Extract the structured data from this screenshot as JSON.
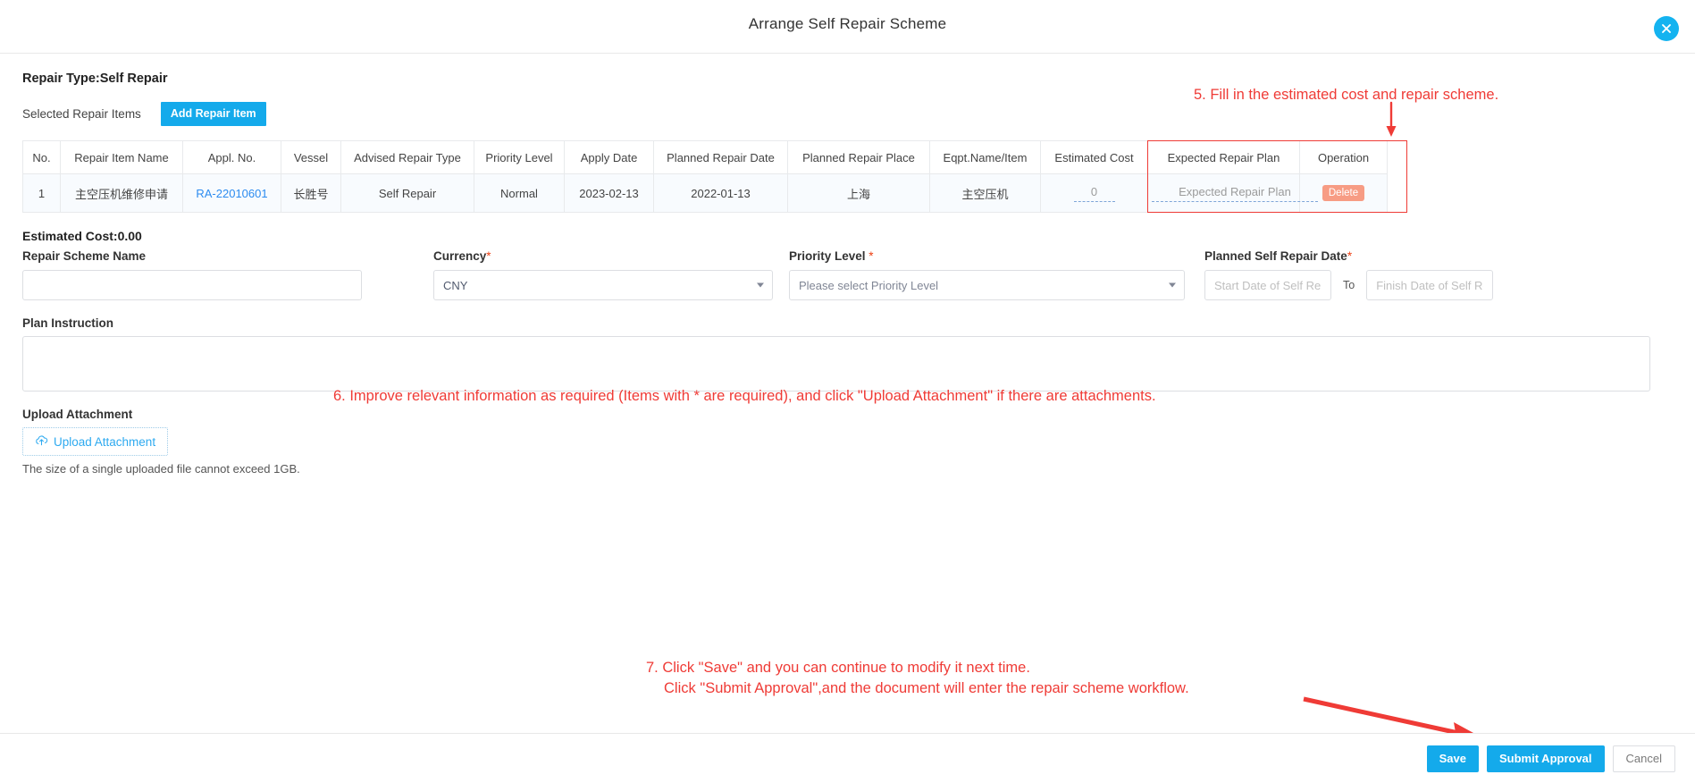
{
  "header": {
    "title": "Arrange Self Repair Scheme",
    "close_icon": "close-circle-icon"
  },
  "body": {
    "repair_type": "Repair Type:Self Repair",
    "selected_items_label": "Selected Repair Items",
    "add_repair_item_label": "Add Repair Item",
    "estimated_cost_summary": "Estimated Cost:0.00"
  },
  "table": {
    "columns": [
      "No.",
      "Repair Item Name",
      "Appl. No.",
      "Vessel",
      "Advised Repair Type",
      "Priority Level",
      "Apply Date",
      "Planned Repair Date",
      "Planned Repair Place",
      "Eqpt.Name/Item",
      "Estimated Cost",
      "Expected Repair Plan",
      "Operation"
    ],
    "rows": [
      {
        "no": "1",
        "repair_item_name": "主空压机维修申请",
        "appl_no": "RA-22010601",
        "vessel": "长胜号",
        "advised_repair_type": "Self Repair",
        "priority_level": "Normal",
        "apply_date": "2023-02-13",
        "planned_repair_date": "2022-01-13",
        "planned_repair_place": "上海",
        "eqpt_name_item": "主空压机",
        "estimated_cost": "0",
        "expected_repair_plan_placeholder": "Expected Repair Plan",
        "operation_label": "Delete"
      }
    ]
  },
  "form": {
    "repair_scheme_name": {
      "label": "Repair Scheme Name",
      "value": "",
      "placeholder": ""
    },
    "currency": {
      "label": "Currency",
      "required_mark": "*",
      "value": "CNY"
    },
    "priority_level": {
      "label": "Priority Level ",
      "required_mark": "*",
      "value": "Please select Priority Level"
    },
    "planned_self_repair_date": {
      "label": "Planned Self Repair Date",
      "required_mark": "*",
      "start_placeholder": "Start Date of Self Repair",
      "separator": "To",
      "end_placeholder": "Finish Date of Self Repair",
      "start_value": "",
      "end_value": ""
    },
    "plan_instruction": {
      "label": "Plan Instruction",
      "value": ""
    },
    "upload": {
      "label": "Upload Attachment",
      "button_label": "Upload Attachment",
      "icon": "cloud-upload-icon",
      "hint": "The size of a single uploaded file cannot exceed 1GB."
    }
  },
  "footer": {
    "save_label": "Save",
    "submit_label": "Submit Approval",
    "cancel_label": "Cancel"
  },
  "annotations": {
    "step5": "5. Fill in the estimated cost and repair scheme.",
    "step6": "6. Improve relevant information as required (Items with * are required), and click \"Upload Attachment\" if there are attachments.",
    "step7_line1": "7. Click \"Save\" and you can continue to modify it next time.",
    "step7_line2": "Click \"Submit Approval\",and the document will enter the repair scheme workflow."
  },
  "colors": {
    "accent": "#14aaeb",
    "annotation": "#ef3b36",
    "link": "#2d8cf0",
    "delete": "#f79c84",
    "required": "#ed4014"
  }
}
